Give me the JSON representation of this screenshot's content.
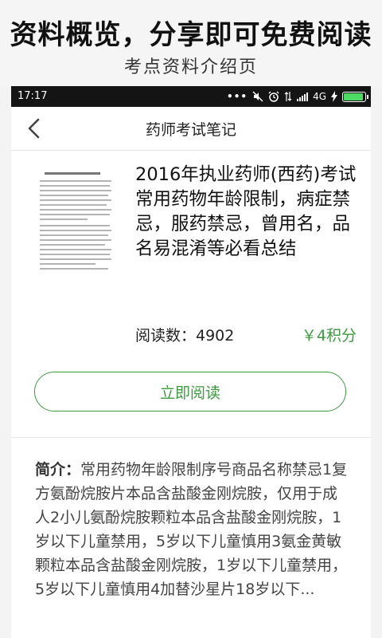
{
  "banner": {
    "title": "资料概览，分享即可免费阅读",
    "subtitle": "考点资料介绍页"
  },
  "status_bar": {
    "time": "17:17",
    "network": "4G",
    "icons": [
      "more-dots-icon",
      "mute-icon",
      "alarm-icon",
      "data-arrows-icon",
      "signal-icon",
      "charging-icon",
      "battery-icon"
    ]
  },
  "nav": {
    "title": "药师考试笔记",
    "back_icon": "chevron-left-icon"
  },
  "book": {
    "title": "2016年执业药师(西药)考试常用药物年龄限制，病症禁忌，服药禁忌，曾用名，品名易混淆等必看总结",
    "reads_label": "阅读数：4902",
    "price": "￥4积分",
    "read_button": "立即阅读",
    "thumbnail_heading": "笔记本电脑保养与维护大全"
  },
  "intro": {
    "label": "简介：",
    "text": "常用药物年龄限制序号商品名称禁忌1复方氨酚烷胺片本品含盐酸金刚烷胺，仅用于成人2小儿氨酚烷胺颗粒本品含盐酸金刚烷胺，1岁以下儿童禁用，5岁以下儿童慎用3氨金黄敏颗粒本品含盐酸金刚烷胺，1岁以下儿童禁用，5岁以下儿童慎用4加替沙星片18岁以下..."
  },
  "colors": {
    "accent": "#3d9a3f",
    "status_bar": "#141414",
    "battery": "#4cd964"
  }
}
